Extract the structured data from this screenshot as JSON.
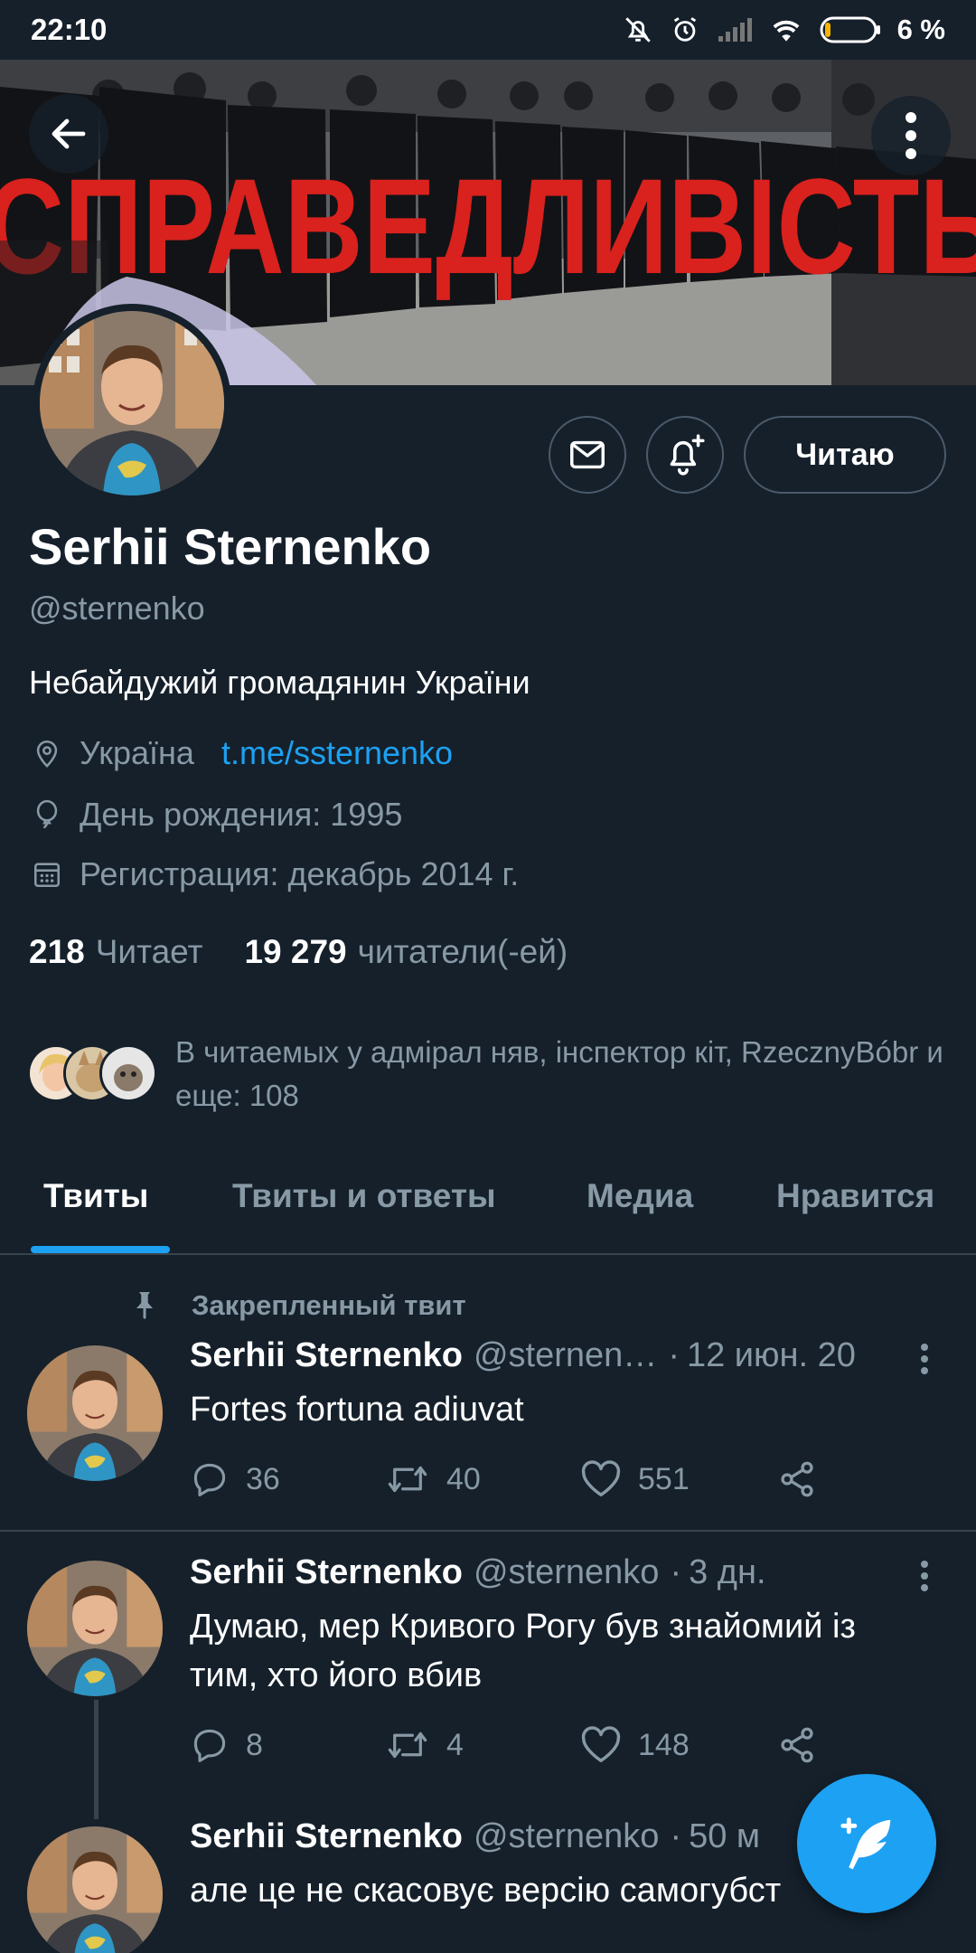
{
  "status_bar": {
    "time": "22:10",
    "battery_percent": "6 %"
  },
  "header": {
    "back_label": "back",
    "more_label": "more"
  },
  "banner": {
    "sign_text": "СПРАВЕДЛИВІСТЬ"
  },
  "profile": {
    "name": "Serhii Sternenko",
    "handle": "@sternenko",
    "bio": "Небайдужий громадянин України",
    "location": "Україна",
    "link": "t.me/ssternenko",
    "birthday": "День рождения: 1995",
    "joined": "Регистрация: декабрь 2014 г.",
    "following_count": "218",
    "following_label": "Читает",
    "followers_count": "19 279",
    "followers_label": "читатели(-ей)",
    "follow_button": "Читаю",
    "followed_by_text": "В читаемых у адмірал няв, інспектор кіт, RzecznyBóbr и еще: 108"
  },
  "tabs": [
    {
      "label": "Твиты",
      "active": true
    },
    {
      "label": "Твиты и ответы",
      "active": false
    },
    {
      "label": "Медиа",
      "active": false
    },
    {
      "label": "Нравится",
      "active": false
    }
  ],
  "tweets": [
    {
      "pinned_label": "Закрепленный твит",
      "name": "Serhii Sternenko",
      "handle": "@sternen…",
      "time": "12 июн. 20",
      "text": "Fortes fortuna adiuvat",
      "replies": "36",
      "retweets": "40",
      "likes": "551"
    },
    {
      "name": "Serhii Sternenko",
      "handle": "@sternenko",
      "time": "3 дн.",
      "text": "Думаю, мер Кривого Рогу був знайомий із тим, хто його вбив",
      "replies": "8",
      "retweets": "4",
      "likes": "148"
    },
    {
      "name": "Serhii Sternenko",
      "handle": "@sternenko",
      "time": "50 м",
      "text": "але це не скасовує версію самогубст"
    }
  ],
  "colors": {
    "background": "#15202b",
    "accent": "#1da1f2",
    "muted": "#8899a6",
    "divider": "#38444d"
  },
  "icons": {
    "back": "arrow-left-icon",
    "more": "vertical-dots-icon",
    "mail": "envelope-icon",
    "bell": "bell-plus-icon",
    "location": "pin-icon",
    "birthday": "balloon-icon",
    "joined": "calendar-icon",
    "pinned": "pushpin-icon",
    "reply": "reply-icon",
    "retweet": "retweet-icon",
    "like": "heart-icon",
    "share": "share-icon",
    "compose": "feather-plus-icon"
  }
}
